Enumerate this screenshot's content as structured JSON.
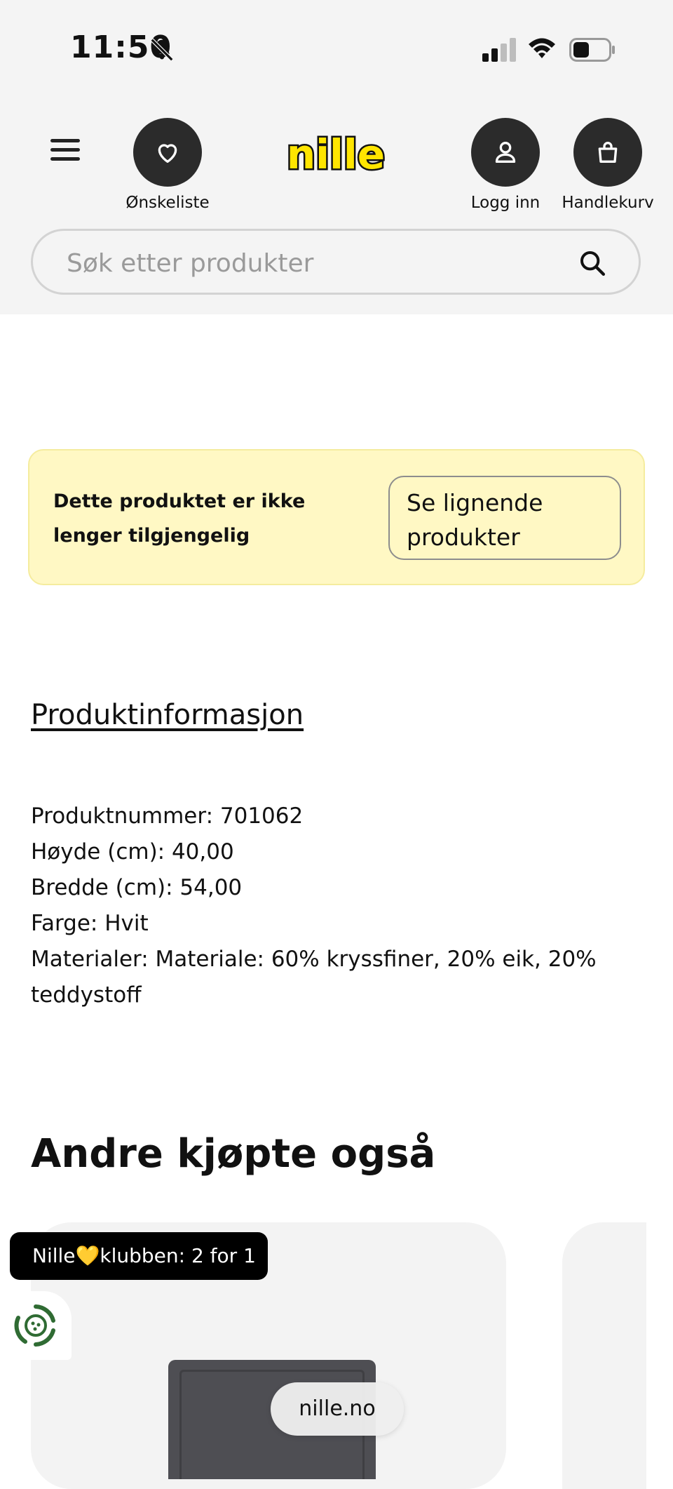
{
  "status_bar": {
    "time": "11:50"
  },
  "header": {
    "wishlist_label": "Ønskeliste",
    "logo_text": "nille",
    "login_label": "Logg inn",
    "cart_label": "Handlekurv"
  },
  "search": {
    "placeholder": "Søk etter produkter"
  },
  "notice": {
    "text": "Dette produktet er ikke lenger tilgjengelig",
    "button_label": "Se lignende produkter"
  },
  "product_info": {
    "title": "Produktinformasjon",
    "items": [
      "Produktnummer: 701062",
      "Høyde (cm): 40,00",
      "Bredde (cm): 54,00",
      "Farge: Hvit",
      "Materialer: Materiale: 60% kryssfiner, 20% eik, 20% teddystoff"
    ]
  },
  "recommendations": {
    "title": "Andre kjøpte også"
  },
  "promo": {
    "text": "Nille💛klubben: 2 for 1"
  },
  "browser": {
    "url": "nille.no"
  },
  "colors": {
    "accent_yellow": "#ffe500",
    "notice_bg": "#fff8c4",
    "dark_button": "#2b2b2b"
  },
  "icons": [
    "bell-slash-icon",
    "signal-icon",
    "wifi-icon",
    "battery-icon",
    "menu-icon",
    "heart-icon",
    "user-icon",
    "shopping-bag-icon",
    "search-icon",
    "recycle-icon"
  ]
}
